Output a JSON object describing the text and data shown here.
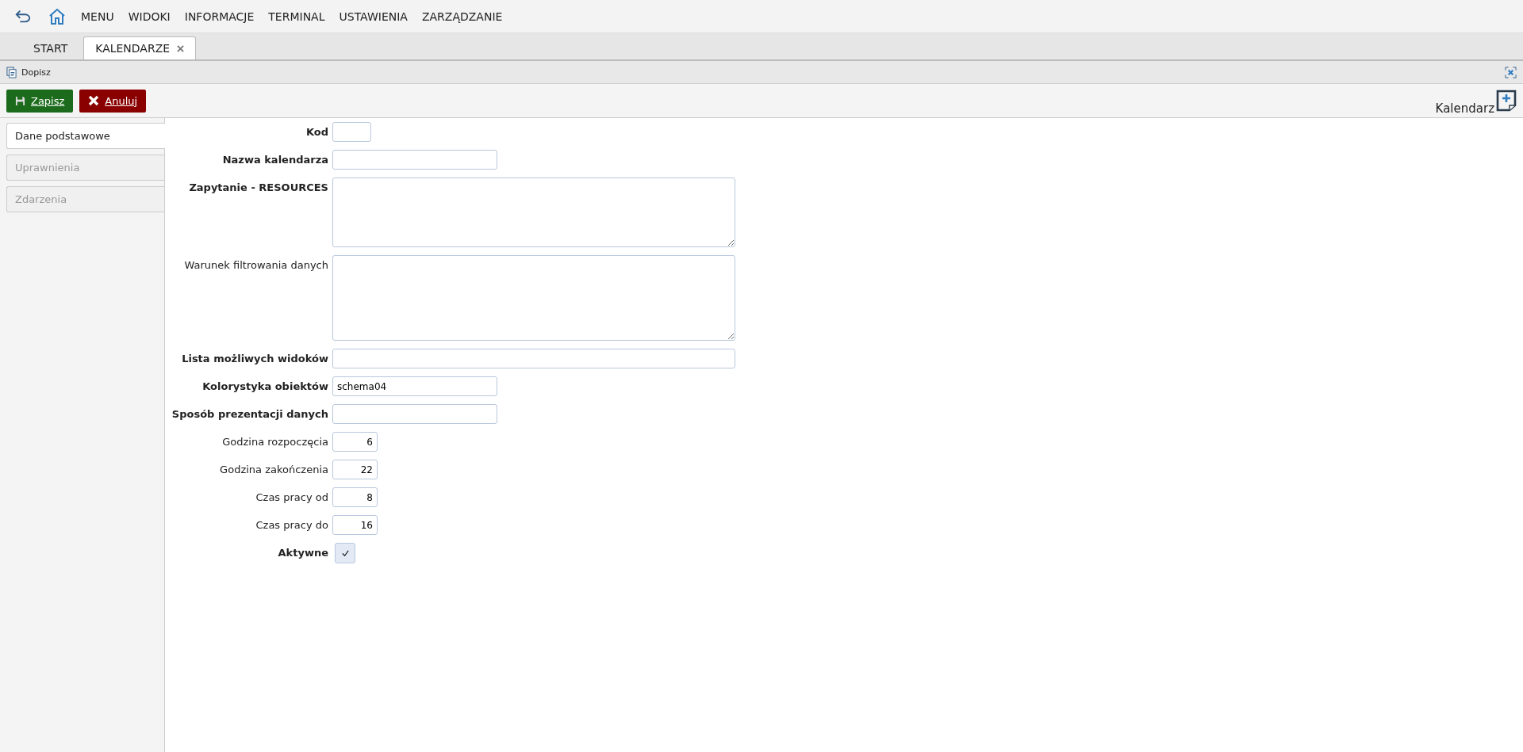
{
  "menu": [
    "MENU",
    "WIDOKI",
    "INFORMACJE",
    "TERMINAL",
    "USTAWIENIA",
    "ZARZĄDZANIE"
  ],
  "tabs": [
    {
      "label": "START",
      "selected": false,
      "closable": false
    },
    {
      "label": "KALENDARZE",
      "selected": true,
      "closable": true
    }
  ],
  "panel_title": "Dopisz",
  "buttons": [
    {
      "label": "Zapisz",
      "kind": "save"
    },
    {
      "label": "Anuluj",
      "kind": "cancel"
    }
  ],
  "form_title": "Kalendarz",
  "sections": [
    {
      "label": "Dane podstawowe",
      "selected": true
    },
    {
      "label": "Uprawnienia",
      "selected": false
    },
    {
      "label": "Zdarzenia",
      "selected": false
    }
  ],
  "fields": [
    {
      "label": "Kod",
      "bold": true,
      "kind": "short"
    },
    {
      "label": "Nazwa kalendarza",
      "bold": true,
      "kind": "medium"
    },
    {
      "label": "Zapytanie - RESOURCES",
      "bold": true,
      "kind": "textarea"
    },
    {
      "label": "Warunek filtrowania danych",
      "bold": false,
      "kind": "textarea-tall"
    },
    {
      "label": "Lista możliwych widoków",
      "bold": true,
      "kind": "wide"
    },
    {
      "label": "Kolorystyka obiektów",
      "bold": true,
      "kind": "medium",
      "value": "schema04"
    },
    {
      "label": "Sposób prezentacji danych",
      "bold": true,
      "kind": "medium"
    },
    {
      "label": "Godzina rozpoczęcia",
      "bold": false,
      "kind": "number",
      "value": "6"
    },
    {
      "label": "Godzina zakończenia",
      "bold": false,
      "kind": "number",
      "value": "22"
    },
    {
      "label": "Czas pracy od",
      "bold": false,
      "kind": "number",
      "value": "8"
    },
    {
      "label": "Czas pracy do",
      "bold": false,
      "kind": "number",
      "value": "16"
    },
    {
      "label": "Aktywne",
      "bold": true,
      "kind": "checkbox",
      "checked": true
    }
  ]
}
